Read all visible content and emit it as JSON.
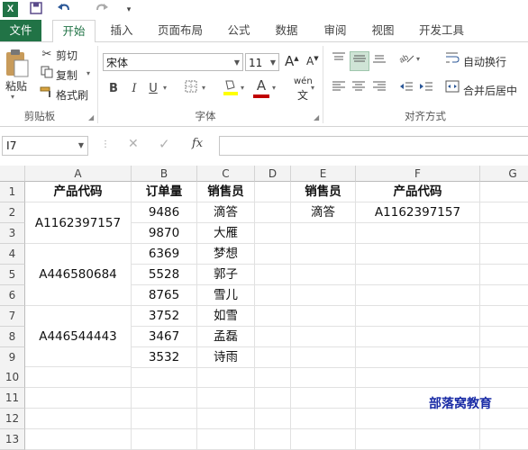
{
  "app": {
    "logo": "X",
    "quick_access": [
      "save-icon",
      "undo-icon",
      "redo-icon",
      "customize-icon"
    ]
  },
  "tabs": [
    "文件",
    "开始",
    "插入",
    "页面布局",
    "公式",
    "数据",
    "审阅",
    "视图",
    "开发工具"
  ],
  "clipboard": {
    "paste": "粘贴",
    "cut": "剪切",
    "copy": "复制",
    "format_painter": "格式刷",
    "group": "剪贴板"
  },
  "font": {
    "name": "宋体",
    "size": "11",
    "bold": "B",
    "italic": "I",
    "underline": "U",
    "grow": "A",
    "shrink": "A",
    "color_letter": "A",
    "phonetic": "wén",
    "group": "字体"
  },
  "alignment": {
    "wrap": "自动换行",
    "merge": "合并后居中",
    "group": "对齐方式"
  },
  "formula_bar": {
    "name_box": "I7",
    "fx": "fx",
    "value": ""
  },
  "columns": [
    "A",
    "B",
    "C",
    "D",
    "E",
    "F",
    "G"
  ],
  "rows": [
    "1",
    "2",
    "3",
    "4",
    "5",
    "6",
    "7",
    "8",
    "9",
    "10",
    "11",
    "12",
    "13"
  ],
  "sheet": {
    "headers": {
      "a": "产品代码",
      "b": "订单量",
      "c": "销售员",
      "e": "销售员",
      "f": "产品代码"
    },
    "product_codes": [
      "A1162397157",
      "A446580684",
      "A446544443"
    ],
    "orders": [
      "9486",
      "9870",
      "6369",
      "5528",
      "8765",
      "3752",
      "3467",
      "3532"
    ],
    "sellers": [
      "滴答",
      "大雁",
      "梦想",
      "郭子",
      "雪儿",
      "如雪",
      "孟磊",
      "诗雨"
    ],
    "lookup": {
      "seller": "滴答",
      "code": "A1162397157"
    }
  },
  "watermark": "部落窝教育",
  "colors": {
    "excel_green": "#217346",
    "font_color": "#c00000",
    "highlight": "#ffff00",
    "watermark": "#1a2ca6"
  }
}
